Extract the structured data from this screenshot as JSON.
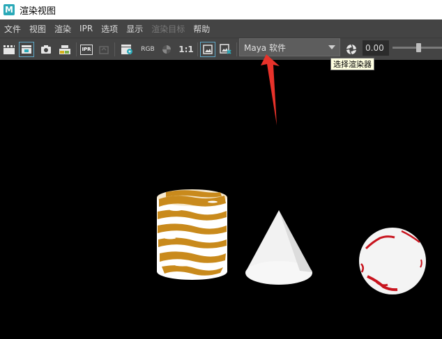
{
  "window": {
    "title": "渲染视图",
    "logo_letter": "M"
  },
  "menu": [
    {
      "label": "文件",
      "enabled": true
    },
    {
      "label": "视图",
      "enabled": true
    },
    {
      "label": "渲染",
      "enabled": true
    },
    {
      "label": "IPR",
      "enabled": true
    },
    {
      "label": "选项",
      "enabled": true
    },
    {
      "label": "显示",
      "enabled": true
    },
    {
      "label": "渲染目标",
      "enabled": false
    },
    {
      "label": "帮助",
      "enabled": true
    }
  ],
  "toolbar": {
    "ipr_label": "IPR",
    "rgb_label": "RGB",
    "ratio_label": "1:1",
    "renderer": {
      "selected": "Maya 软件"
    },
    "exposure_value": "0.00",
    "exposure_slider_fraction": 0.5
  },
  "tooltip": {
    "text": "选择渲染器"
  },
  "colors": {
    "panel": "#444444",
    "annotation_arrow": "#e8322a",
    "cylinder_texture": "#c98a1c",
    "sphere_texture": "#c8141e"
  }
}
